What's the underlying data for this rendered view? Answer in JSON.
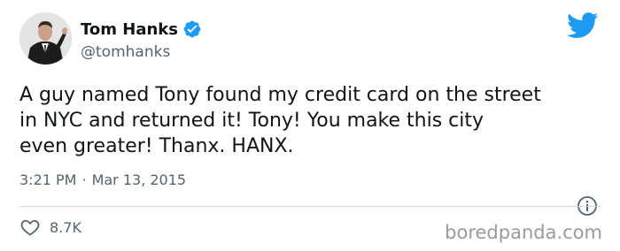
{
  "author": {
    "display_name": "Tom Hanks",
    "handle": "@tomhanks",
    "avatar_icon": "profile-photo",
    "verified_icon": "verified-badge-icon"
  },
  "tweet": {
    "lines": [
      "A guy named Tony found my credit card on the street",
      "in NYC and returned it!  Tony!  You make this city",
      "even greater!  Thanx. HANX."
    ]
  },
  "meta": {
    "time": "3:21 PM",
    "separator": "·",
    "date": "Mar 13, 2015"
  },
  "actions": {
    "like_count": "8.7K"
  },
  "brand": {
    "twitter_blue": "#1d9bf0",
    "watermark": "boredpanda.com"
  }
}
